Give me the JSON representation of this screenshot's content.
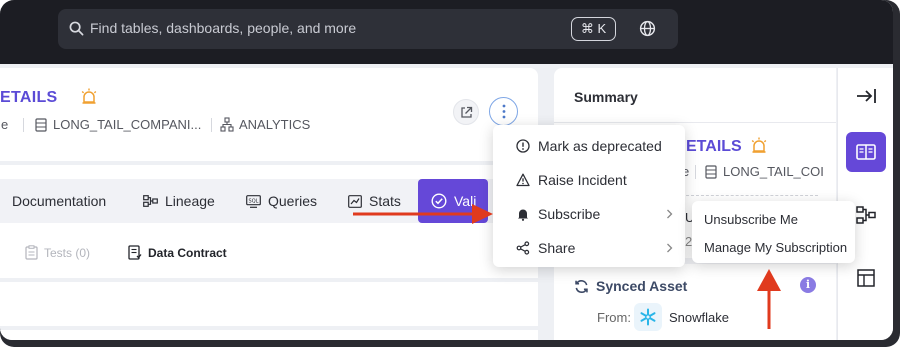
{
  "topbar": {
    "search_placeholder": "Find tables, dashboards, people, and more",
    "shortcut": "⌘ K"
  },
  "asset": {
    "title": "ETAILS",
    "type_fragment": "e",
    "schema": "LONG_TAIL_COMPANI...",
    "database": "ANALYTICS"
  },
  "tabs": [
    {
      "label": "Documentation",
      "icon": "document-icon"
    },
    {
      "label": "Lineage",
      "icon": "lineage-icon"
    },
    {
      "label": "Queries",
      "icon": "sql-icon"
    },
    {
      "label": "Stats",
      "icon": "chart-icon"
    },
    {
      "label": "Vali",
      "icon": "check-circle-icon",
      "active": true
    }
  ],
  "subtabs": [
    {
      "label": "Tests (0)",
      "dim": true
    },
    {
      "label": "Data Contract",
      "dim": false
    }
  ],
  "menu": {
    "items": [
      {
        "label": "Mark as deprecated",
        "icon": "info-circle-icon"
      },
      {
        "label": "Raise Incident",
        "icon": "warning-icon"
      },
      {
        "label": "Subscribe",
        "icon": "bell-icon",
        "submenu": true
      },
      {
        "label": "Share",
        "icon": "share-icon",
        "submenu": true
      }
    ]
  },
  "submenu": {
    "items": [
      {
        "label": "Unsubscribe Me"
      },
      {
        "label": "Manage My Subscription"
      }
    ]
  },
  "summary": {
    "title": "Summary",
    "asset_title": "ETAILS",
    "type_fragment": "e",
    "schema": "LONG_TAIL_COI",
    "owner_fragment": "U",
    "date_fragment": "2",
    "synced_label": "Synced Asset",
    "info": "i",
    "from_label": "From:",
    "source": "Snowflake"
  },
  "colors": {
    "accent": "#6548d8",
    "title": "#5b4bd6",
    "alert": "#f0a030",
    "annotation": "#e03a1e"
  }
}
